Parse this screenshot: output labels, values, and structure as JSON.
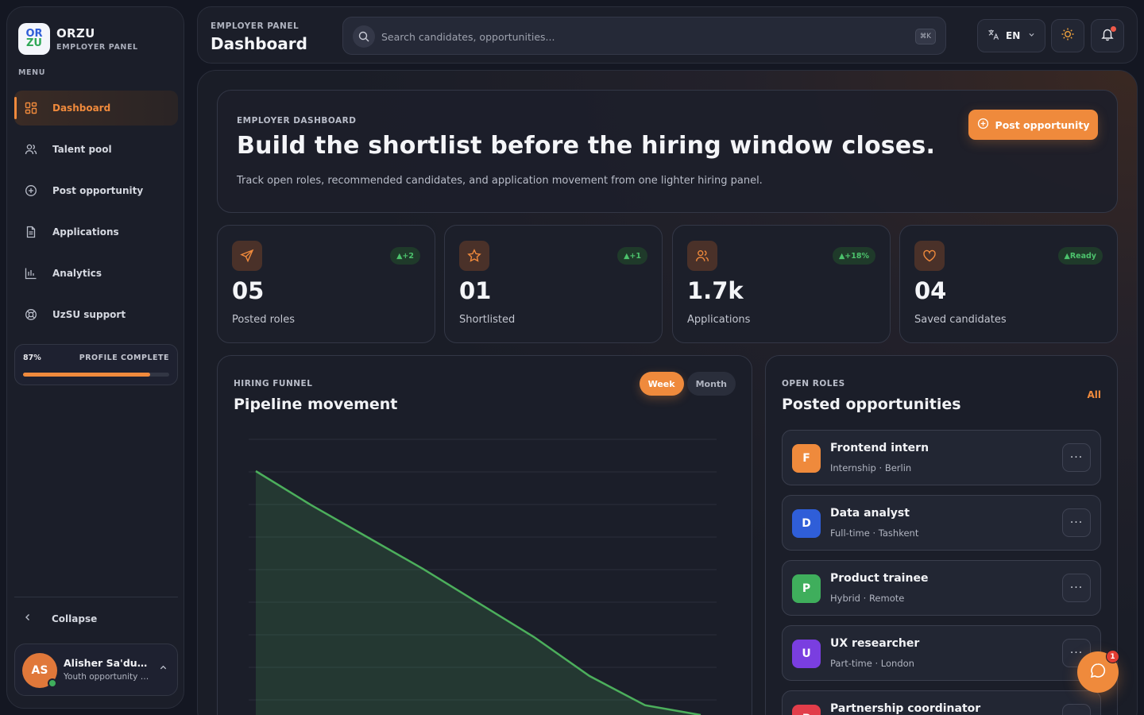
{
  "brand": {
    "logo_top": "OR",
    "logo_bottom": "ZU",
    "name": "ORZU",
    "subtitle": "EMPLOYER PANEL"
  },
  "sidebar": {
    "menu_label": "MENU",
    "items": [
      {
        "label": "Dashboard",
        "icon": "grid-icon",
        "active": true
      },
      {
        "label": "Talent pool",
        "icon": "users-icon"
      },
      {
        "label": "Post opportunity",
        "icon": "plus-circle-icon"
      },
      {
        "label": "Applications",
        "icon": "document-icon"
      },
      {
        "label": "Analytics",
        "icon": "bar-chart-icon"
      },
      {
        "label": "UzSU support",
        "icon": "lifebuoy-icon"
      }
    ],
    "profile_complete": {
      "percent_label": "87%",
      "label": "PROFILE COMPLETE",
      "value": 0.87
    },
    "collapse_label": "Collapse",
    "user": {
      "initials": "AS",
      "name": "Alisher Sa'dullayev",
      "role": "Youth opportunity manager",
      "status": "online"
    }
  },
  "topbar": {
    "subtitle": "EMPLOYER PANEL",
    "title": "Dashboard",
    "search": {
      "placeholder": "Search candidates, opportunities...",
      "shortcut": "⌘K"
    },
    "language": "EN"
  },
  "hero": {
    "eyebrow": "EMPLOYER DASHBOARD",
    "title": "Build the shortlist before the hiring window closes.",
    "description": "Track open roles, recommended candidates, and application movement from one lighter hiring panel.",
    "cta": "Post opportunity"
  },
  "stats": [
    {
      "icon": "send-icon",
      "badge": "▲+2",
      "value": "05",
      "label": "Posted roles"
    },
    {
      "icon": "star-icon",
      "badge": "▲+1",
      "value": "01",
      "label": "Shortlisted"
    },
    {
      "icon": "users-icon",
      "badge": "▲+18%",
      "value": "1.7k",
      "label": "Applications"
    },
    {
      "icon": "heart-icon",
      "badge": "▲Ready",
      "value": "04",
      "label": "Saved candidates"
    }
  ],
  "funnel": {
    "eyebrow": "HIRING FUNNEL",
    "title": "Pipeline movement",
    "toggle": [
      "Week",
      "Month"
    ],
    "active_toggle": "Week"
  },
  "chart_data": {
    "type": "area",
    "title": "Pipeline movement",
    "xlabel": "",
    "ylabel": "",
    "grid": true,
    "series": [
      {
        "values": [
          100,
          86,
          73,
          60,
          46,
          32,
          16,
          4,
          0
        ]
      }
    ],
    "ylim": [
      0,
      110
    ],
    "color": "#4caf5c"
  },
  "roles": {
    "eyebrow": "OPEN ROLES",
    "title": "Posted opportunities",
    "all_label": "All",
    "items": [
      {
        "initial": "F",
        "title": "Frontend intern",
        "meta": "Internship · Berlin",
        "color": "#ef8a3c"
      },
      {
        "initial": "D",
        "title": "Data analyst",
        "meta": "Full-time · Tashkent",
        "color": "#2f5ed8"
      },
      {
        "initial": "P",
        "title": "Product trainee",
        "meta": "Hybrid · Remote",
        "color": "#3fae5c"
      },
      {
        "initial": "U",
        "title": "UX researcher",
        "meta": "Part-time · London",
        "color": "#7a3ee0"
      },
      {
        "initial": "P",
        "title": "Partnership coordinator",
        "meta": "",
        "color": "#e23d4a"
      }
    ],
    "more_label": "···"
  },
  "chat": {
    "badge": "1"
  }
}
